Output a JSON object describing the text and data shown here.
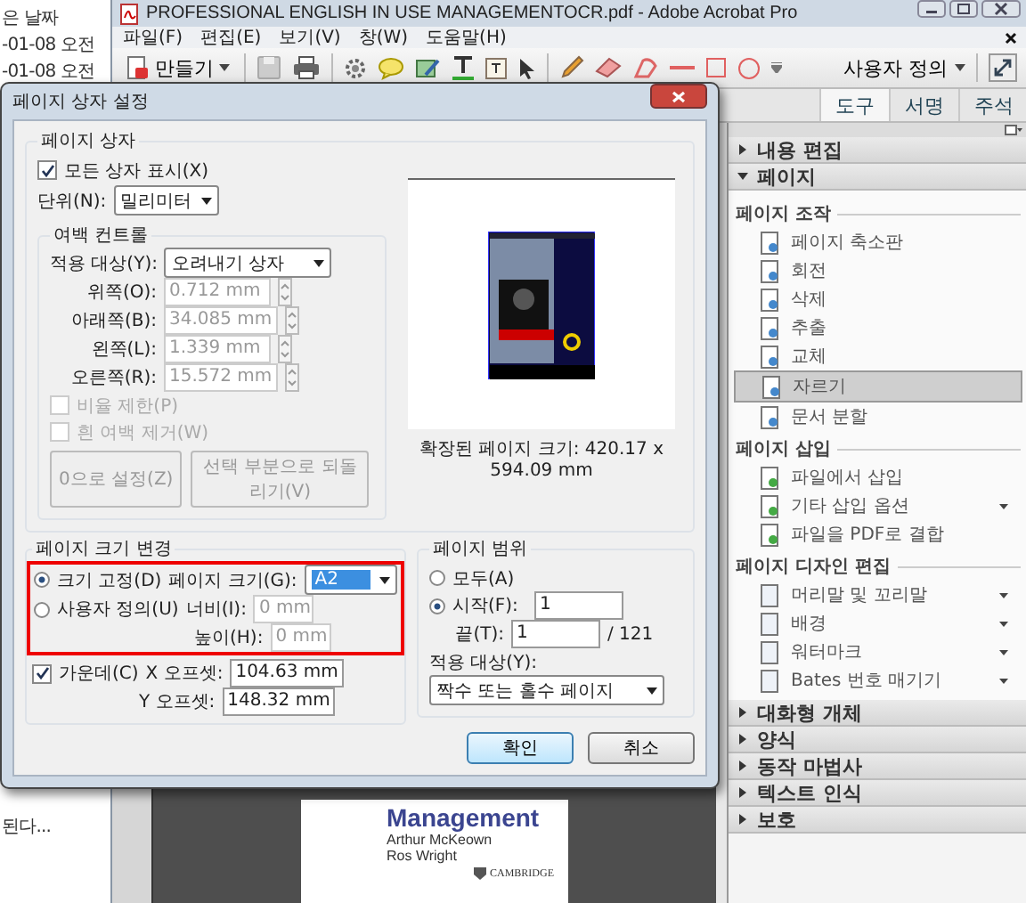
{
  "explorer": {
    "texts": [
      "은 날짜",
      "-01-08 오전",
      "-01-08 오전",
      "된다..."
    ]
  },
  "app": {
    "title": "PROFESSIONAL ENGLISH IN USE MANAGEMENTOCR.pdf - Adobe Acrobat Pro",
    "menu": [
      "파일(F)",
      "편집(E)",
      "보기(V)",
      "창(W)",
      "도움말(H)"
    ],
    "create_button": "만들기",
    "view_mode": "사용자 정의",
    "tabs": [
      {
        "label": "도구",
        "selected": true
      },
      {
        "label": "서명",
        "selected": false
      },
      {
        "label": "주석",
        "selected": false
      }
    ],
    "document": {
      "heading": "Management",
      "authors": [
        "Arthur McKeown",
        "Ros Wright"
      ],
      "publisher": "CAMBRIDGE"
    },
    "sections": [
      {
        "label": "내용 편집",
        "expanded": false
      },
      {
        "label": "페이지",
        "expanded": true,
        "groups": [
          {
            "title": "페이지 조작",
            "items": [
              {
                "label": "페이지 축소판",
                "selected": false,
                "has_menu": false
              },
              {
                "label": "회전",
                "selected": false,
                "has_menu": false
              },
              {
                "label": "삭제",
                "selected": false,
                "has_menu": false
              },
              {
                "label": "추출",
                "selected": false,
                "has_menu": false
              },
              {
                "label": "교체",
                "selected": false,
                "has_menu": false
              },
              {
                "label": "자르기",
                "selected": true,
                "has_menu": false
              },
              {
                "label": "문서 분할",
                "selected": false,
                "has_menu": false
              }
            ]
          },
          {
            "title": "페이지 삽입",
            "items": [
              {
                "label": "파일에서 삽입",
                "selected": false,
                "has_menu": false
              },
              {
                "label": "기타 삽입 옵션",
                "selected": false,
                "has_menu": true
              },
              {
                "label": "파일을 PDF로 결합",
                "selected": false,
                "has_menu": false
              }
            ]
          },
          {
            "title": "페이지 디자인 편집",
            "items": [
              {
                "label": "머리말 및 꼬리말",
                "selected": false,
                "has_menu": true
              },
              {
                "label": "배경",
                "selected": false,
                "has_menu": true
              },
              {
                "label": "워터마크",
                "selected": false,
                "has_menu": true
              },
              {
                "label": "Bates 번호 매기기",
                "selected": false,
                "has_menu": true
              }
            ]
          }
        ]
      },
      {
        "label": "대화형 개체",
        "expanded": false
      },
      {
        "label": "양식",
        "expanded": false
      },
      {
        "label": "동작 마법사",
        "expanded": false
      },
      {
        "label": "텍스트 인식",
        "expanded": false
      },
      {
        "label": "보호",
        "expanded": false
      }
    ]
  },
  "dialog": {
    "title": "페이지 상자 설정",
    "page_boxes": {
      "legend": "페이지 상자",
      "show_all": {
        "label": "모든 상자 표시(X)",
        "checked": true
      },
      "unit": {
        "label": "단위(N):",
        "value": "밀리미터"
      },
      "margins": {
        "legend": "여백 컨트롤",
        "apply_to": {
          "label": "적용 대상(Y):",
          "value": "오려내기 상자"
        },
        "fields": [
          {
            "label": "위쪽(O):",
            "value": "0.712 mm",
            "disabled": true
          },
          {
            "label": "아래쪽(B):",
            "value": "34.085 mm",
            "disabled": true
          },
          {
            "label": "왼쪽(L):",
            "value": "1.339 mm",
            "disabled": true
          },
          {
            "label": "오른쪽(R):",
            "value": "15.572 mm",
            "disabled": true
          }
        ],
        "checkboxes": [
          {
            "label": "비율 제한(P)",
            "checked": false,
            "disabled": true
          },
          {
            "label": "흰 여백 제거(W)",
            "checked": false,
            "disabled": true
          }
        ],
        "buttons": [
          {
            "label": "0으로 설정(Z)",
            "disabled": true
          },
          {
            "label": "선택 부분으로 되돌리기(V)",
            "disabled": true
          }
        ]
      },
      "preview_caption": "확장된 페이지 크기: 420.17 x 594.09 mm"
    },
    "page_size": {
      "legend": "페이지 크기 변경",
      "highlighted": true,
      "fixed": {
        "label": "크기 고정(D)",
        "selected": true
      },
      "size": {
        "label": "페이지 크기(G):",
        "value": "A2"
      },
      "custom": {
        "label": "사용자 정의(U)",
        "selected": false
      },
      "width": {
        "label": "너비(I):",
        "value": "0 mm",
        "disabled": true
      },
      "height": {
        "label": "높이(H):",
        "value": "0 mm",
        "disabled": true
      },
      "center": {
        "label": "가운데(C)",
        "checked": true
      },
      "x_offset": {
        "label": "X 오프셋:",
        "value": "104.63 mm"
      },
      "y_offset": {
        "label": "Y 오프셋:",
        "value": "148.32 mm"
      }
    },
    "page_range": {
      "legend": "페이지 범위",
      "all": {
        "label": "모두(A)",
        "selected": false
      },
      "from": {
        "label": "시작(F):",
        "selected": true,
        "value": "1"
      },
      "to": {
        "label": "끝(T):",
        "value": "1"
      },
      "total": "/ 121",
      "apply_to": {
        "label": "적용 대상(Y):",
        "value": "짝수 또는 홀수 페이지"
      }
    },
    "buttons": [
      {
        "label": "확인",
        "kind": "primary"
      },
      {
        "label": "취소",
        "kind": "secondary"
      }
    ]
  }
}
